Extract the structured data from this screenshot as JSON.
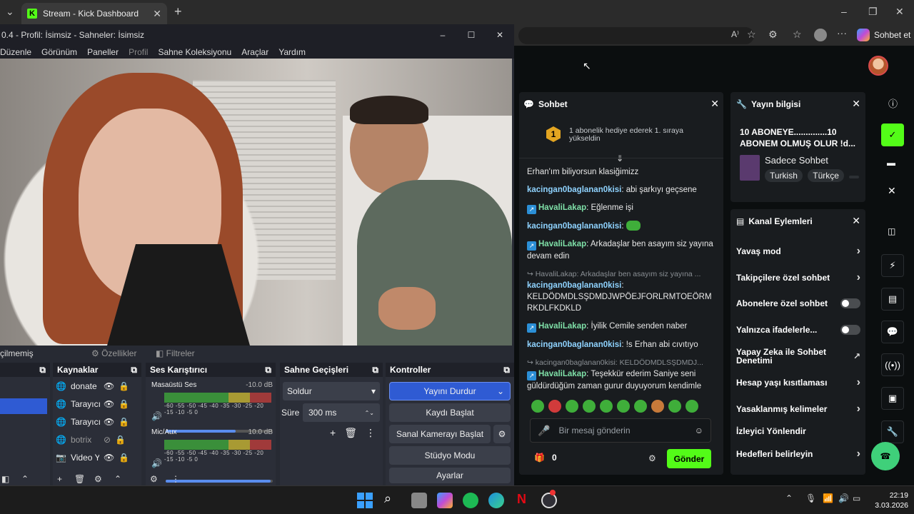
{
  "browser": {
    "tab_title": "Stream - Kick Dashboard",
    "copilot_label": "Sohbet et"
  },
  "obs": {
    "title": "0.4 - Profil: İsimsiz - Sahneler: İsimsiz",
    "menu": [
      "Düzenle",
      "Görünüm",
      "Paneller",
      "Profil",
      "Sahne Koleksiyonu",
      "Araçlar",
      "Yardım"
    ],
    "selected_label": "çilmemiş",
    "tab_props": "Özellikler",
    "tab_filters": "Filtreler",
    "sources_title": "Kaynaklar",
    "sources": [
      "donate",
      "Tarayıcı",
      "Tarayıcı",
      "botrix",
      "Video Y..."
    ],
    "mixer_title": "Ses Karıştırıcı",
    "mixer": [
      {
        "name": "Masaüstü Ses",
        "db": "-10.0 dB",
        "volume": 0.65
      },
      {
        "name": "Mic/Aux",
        "db": "10.0 dB",
        "volume": 0.98
      }
    ],
    "meter_ticks": "-60 -55 -50 -45 -40 -35 -30 -25 -20 -15 -10 -5 0",
    "transitions_title": "Sahne Geçişleri",
    "transition": "Soldur",
    "duration_label": "Süre",
    "duration": "300 ms",
    "controls_title": "Kontroller",
    "controls": {
      "stop_stream": "Yayını Durdur",
      "record": "Kaydı Başlat",
      "virtual_cam": "Sanal Kamerayı Başlat",
      "studio": "Stüdyo Modu",
      "settings": "Ayarlar"
    }
  },
  "chat": {
    "title": "Sohbet",
    "pinned_rank": "1",
    "pinned_text": "1 abonelik hediye ederek 1. sıraya yükseldin",
    "messages": [
      {
        "text": "Erhan'ım biliyorsun klasiğimizz"
      },
      {
        "user": "kacingan0baglanan0kisi",
        "text": "abi şarkıyı geçsene"
      },
      {
        "user": "HavaliLakap",
        "text": "Eğlenme işi"
      },
      {
        "user": "kacingan0baglanan0kisi",
        "text": ""
      },
      {
        "user": "HavaliLakap",
        "text": "Arkadaşlar ben asayım siz yayına devam edin"
      },
      {
        "reply": "HavaliLakap: Arkadaşlar ben asayım siz yayına ...",
        "user": "kacingan0baglanan0kisi",
        "text": "KELDÖDMDLSŞDMDJWPÖEJFORLRMTOEÖRMRKDLFKDKLD"
      },
      {
        "user": "HavaliLakap",
        "text": "İyilik Cemile senden naber"
      },
      {
        "user": "kacingan0baglanan0kisi",
        "text": "!s Erhan abi cıvıtıyo"
      },
      {
        "reply": "kacingan0baglanan0kisi: KELDÖDMDLSŞDMDJ...",
        "user": "HavaliLakap",
        "text": "Teşekkür ederim Saniye seni güldürdüğüm zaman gurur duyuyorum kendimle"
      }
    ],
    "input_placeholder": "Bir mesaj gönderin",
    "points": "0",
    "send_label": "Gönder"
  },
  "stream_info": {
    "title": "Yayın bilgisi",
    "stream_title": "10 ABONEYE..............10 ABONEM OLMUŞ OLUR !d...",
    "category": "Sadece Sohbet",
    "tags": [
      "Turkish",
      "Türkçe"
    ]
  },
  "channel_actions": {
    "title": "Kanal Eylemleri",
    "items": [
      {
        "label": "Yavaş mod",
        "control": "chevron"
      },
      {
        "label": "Takipçilere özel sohbet",
        "control": "chevron"
      },
      {
        "label": "Abonelere özel sohbet",
        "control": "toggle"
      },
      {
        "label": "Yalnızca ifadelerle...",
        "control": "toggle"
      },
      {
        "label": "Yapay Zeka ile Sohbet Denetimi",
        "control": "external"
      },
      {
        "label": "Hesap yaşı kısıtlaması",
        "control": "chevron"
      },
      {
        "label": "Yasaklanmış kelimeler",
        "control": "chevron"
      },
      {
        "label": "İzleyici Yönlendir",
        "control": "none"
      },
      {
        "label": "Hedefleri belirleyin",
        "control": "chevron"
      }
    ]
  },
  "taskbar": {
    "time": "22:19",
    "date": "3.03.2026"
  },
  "colors": {
    "kick_green": "#53fc18",
    "obs_blue": "#2f5bd3"
  }
}
